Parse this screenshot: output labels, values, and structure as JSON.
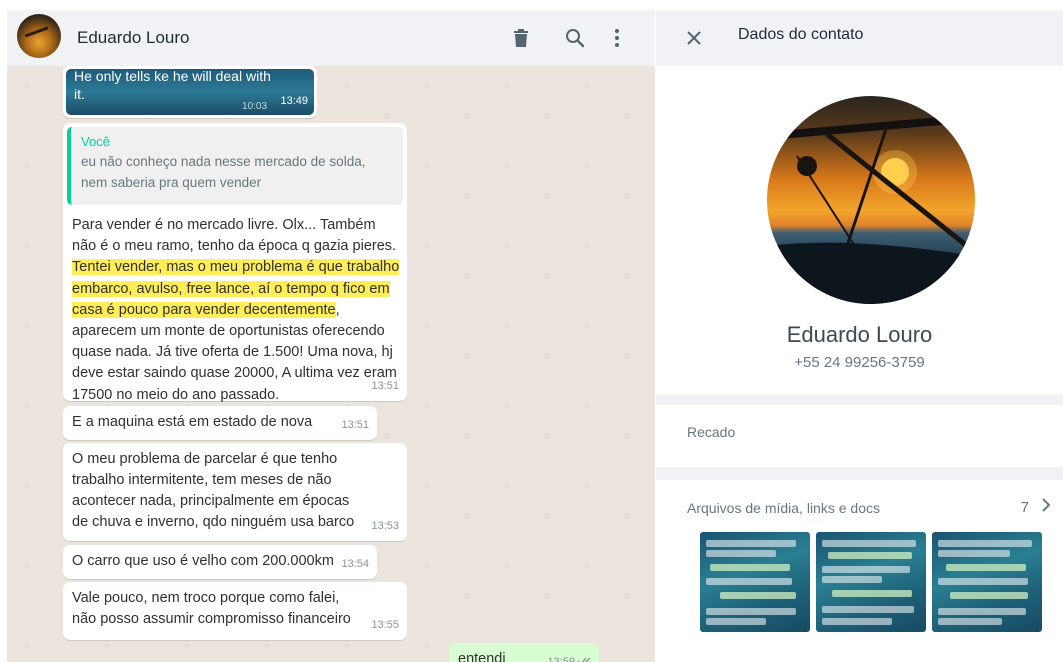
{
  "chat": {
    "contact_name": "Eduardo Louro",
    "icons": {
      "avatar": "contact-avatar",
      "delete": "trash-icon",
      "search": "search-icon",
      "menu": "more-vertical-icon"
    },
    "image_message": {
      "caption": "He only tells ke he will deal with it.",
      "inner_time": "10:03",
      "time": "13:49"
    },
    "reply_message": {
      "quoted_author": "Você",
      "quoted_text": "eu não conheço nada nesse mercado de solda, nem saberia pra quem vender",
      "text_before_highlight": "Para vender é  no mercado livre. Olx... Também não  é  o meu ramo, tenho da época  q gazia pieres. ",
      "text_highlight": "Tentei vender, mas o meu problema é  que trabalho embarco, avulso, free lance, aí o tempo q fico em casa é  pouco para vender decentemente",
      "text_after_highlight": ", aparecem um monte de oportunistas oferecendo quase nada. Já  tive oferta de 1.500! Uma nova, hj deve estar saindo quase 20000, A ultima vez eram 17500 no meio do ano passado.",
      "time": "13:51"
    },
    "messages": [
      {
        "text": "E a maquina está  em estado de nova",
        "time": "13:51"
      },
      {
        "text": "O meu problema de parcelar é  que tenho trabalho intermitente, tem meses de não acontecer nada, principalmente em épocas de chuva e inverno, qdo ninguém usa barco",
        "time": "13:53"
      },
      {
        "text": "O carro que uso é  velho com 200.000km",
        "time": "13:54"
      },
      {
        "text": "Vale pouco, nem troco porque como falei, não posso assumir compromisso financeiro",
        "time": "13:55"
      }
    ],
    "outgoing_message": {
      "text": "entendi",
      "time": "13:59",
      "status_icon": "double-check-icon"
    }
  },
  "contact_info": {
    "title": "Dados do contato",
    "close_icon": "close-icon",
    "name": "Eduardo Louro",
    "phone": "+55 24 99256-3759",
    "about_label": "Recado",
    "media": {
      "label": "Arquivos de mídia, links e docs",
      "count": "7",
      "chevron_icon": "chevron-right-icon"
    }
  },
  "colors": {
    "accent": "#06cf9c",
    "highlight": "#ffee58",
    "outgoing_bubble": "#d9fdd3",
    "chat_background": "#ebe5de"
  }
}
